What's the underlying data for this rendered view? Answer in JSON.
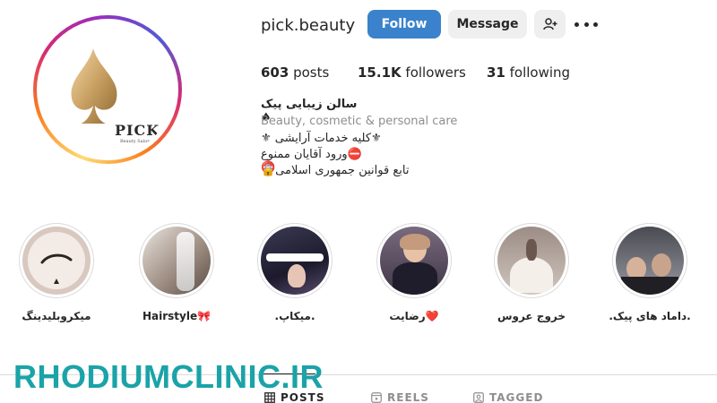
{
  "profile": {
    "username": "pick.beauty",
    "follow_label": "Follow",
    "message_label": "Message",
    "add_user_icon": "add-user-icon",
    "more_icon": "more-options-icon",
    "avatar_logo_text": "PICK",
    "avatar_logo_sub": "Beauty Salon"
  },
  "stats": {
    "posts_count": "603",
    "posts_label": " posts",
    "followers_count": "15.1K",
    "followers_label": " followers",
    "following_count": "31",
    "following_label": " following"
  },
  "bio": {
    "name": "سالن زیبایی پیک ♠",
    "category": "Beauty, cosmetic & personal care",
    "lines": [
      "⚜کلیه خدمات آرایشی ⚜",
      "⛔ورود آقایان ممنوع ⛔",
      "تابع قوانین جمهوری اسلامی🔒"
    ]
  },
  "highlights": [
    {
      "label": "میکروبلیدینگ"
    },
    {
      "label": "Hairstyle🎀"
    },
    {
      "label": ".میکاپ."
    },
    {
      "label": "رضایت❤️"
    },
    {
      "label": "خروج عروس"
    },
    {
      "label": ".داماد های پیک."
    }
  ],
  "tabs": {
    "posts": "POSTS",
    "reels": "REELS",
    "tagged": "TAGGED"
  },
  "watermark": "RHODIUMCLINIC.IR",
  "colors": {
    "follow_button": "#3b82cc",
    "text_primary": "#262626",
    "text_secondary": "#8e8e8e",
    "watermark": "#1aa3a8"
  }
}
